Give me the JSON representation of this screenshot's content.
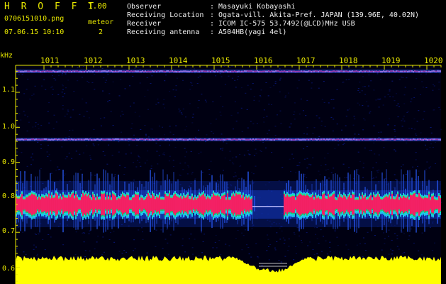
{
  "header": {
    "app_title": "H R O F F T",
    "app_version": "1.00",
    "filename": "0706151010.png",
    "meteor_label": "meteor",
    "datetime": "07.06.15 10:10",
    "meteor_count": "2",
    "info": [
      {
        "label": "Observer",
        "value": ": Masayuki Kobayashi"
      },
      {
        "label": "Receiving Location",
        "value": ": Ogata-vill. Akita-Pref. JAPAN (139.96E, 40.02N)"
      },
      {
        "label": "Receiver",
        "value": ": ICOM IC-575 53.7492(@LCD)MHz USB"
      },
      {
        "label": "Receiving antenna",
        "value": ": A504HB(yagi 4el)"
      }
    ]
  },
  "axes": {
    "y_unit": "kHz",
    "y_ticks": [
      "1.1",
      "1.0",
      "0.9",
      "0.8",
      "0.7",
      "0.6"
    ],
    "x_ticks": [
      "1011",
      "1012",
      "1013",
      "1014",
      "1015",
      "1016",
      "1017",
      "1018",
      "1019",
      "1020"
    ]
  },
  "colors": {
    "label_yellow": "#e8e800",
    "label_white": "#f0f0f0",
    "noise_blue": "#0a1a8a",
    "band_red": "#ff2060",
    "band_cyan": "#20e0ff",
    "band_green": "#20ff60",
    "level_yellow": "#ffff00"
  }
}
